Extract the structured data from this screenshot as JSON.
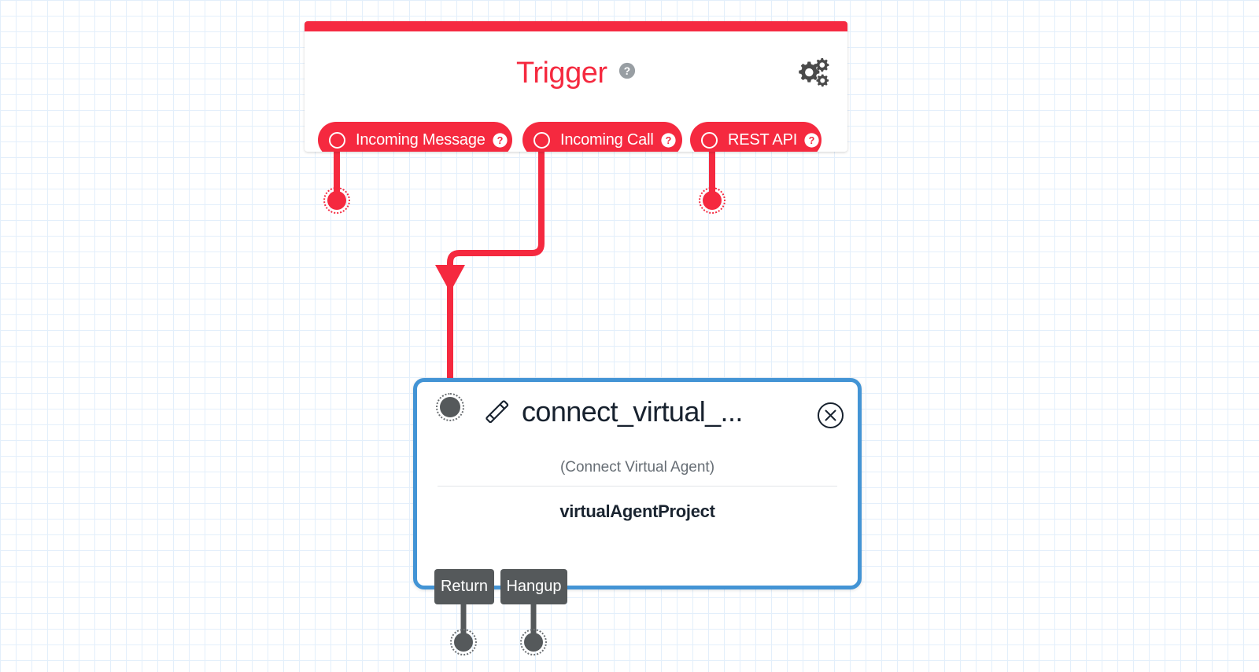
{
  "canvas": {
    "background_color": "#ffffff",
    "grid_color": "#e3effb",
    "grid_size_px": 20
  },
  "trigger_node": {
    "title": "Trigger",
    "accent_color": "#f5293f",
    "title_help_icon": "help-circle-icon",
    "settings_icon": "cogs-icon",
    "options": [
      {
        "label": "Incoming Message",
        "selected": false,
        "help_icon": "help-circle-icon",
        "port": "output-port"
      },
      {
        "label": "Incoming Call",
        "selected": false,
        "help_icon": "help-circle-icon",
        "port": "output-port"
      },
      {
        "label": "REST API",
        "selected": false,
        "help_icon": "help-circle-icon",
        "port": "output-port"
      }
    ]
  },
  "action_card": {
    "icon": "phone-handset-icon",
    "title": "connect_virtual_...",
    "subtitle": "(Connect Virtual Agent)",
    "parameter": "virtualAgentProject",
    "close_icon": "close-circle-icon",
    "border_color": "#4394d5",
    "input_port": "input-port",
    "outputs": [
      {
        "label": "Return"
      },
      {
        "label": "Hangup"
      }
    ]
  },
  "connections": [
    {
      "from": "Incoming Message",
      "to": "unconnected-port",
      "color": "#f5293f"
    },
    {
      "from": "Incoming Call",
      "to": "connect_virtual_...",
      "color": "#f5293f",
      "has_arrowhead": true
    },
    {
      "from": "REST API",
      "to": "unconnected-port",
      "color": "#f5293f"
    },
    {
      "from": "Return",
      "to": "unconnected-port",
      "color": "#55595b"
    },
    {
      "from": "Hangup",
      "to": "unconnected-port",
      "color": "#55595b"
    }
  ]
}
